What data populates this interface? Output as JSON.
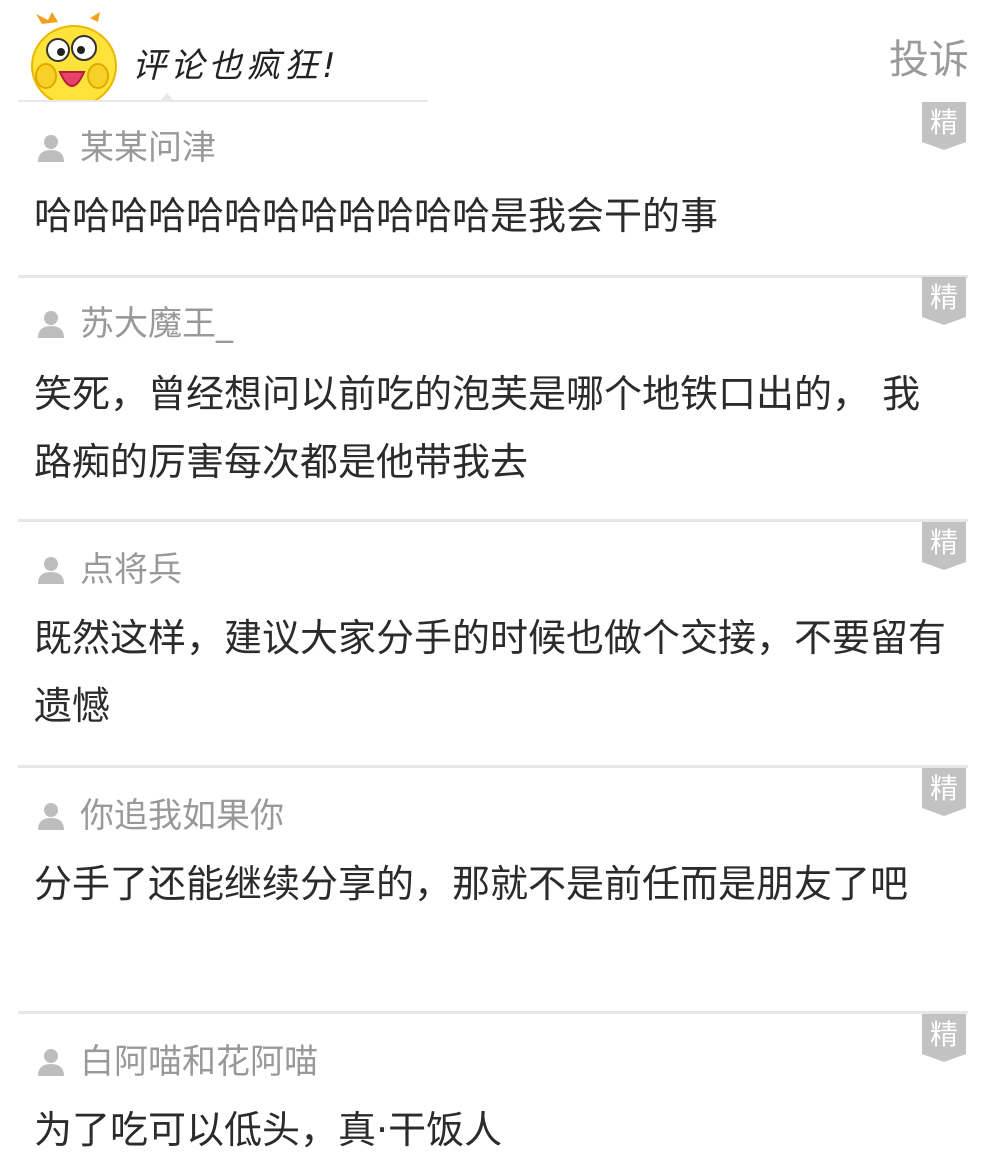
{
  "header": {
    "title": "评论也疯狂!",
    "report_label": "投诉",
    "mascot_icon": "yellow-chick-mascot-icon"
  },
  "badge_label": "精",
  "comments": [
    {
      "username": "某某问津",
      "text": "哈哈哈哈哈哈哈哈哈哈哈哈是我会干的事"
    },
    {
      "username": "苏大魔王_",
      "text": "笑死，曾经想问以前吃的泡芙是哪个地铁口出的， 我路痴的厉害每次都是他带我去"
    },
    {
      "username": "点将兵",
      "text": "既然这样，建议大家分手的时候也做个交接，不要留有遗憾"
    },
    {
      "username": "你追我如果你",
      "text": "分手了还能继续分享的，那就不是前任而是朋友了吧"
    },
    {
      "username": "白阿喵和花阿喵",
      "text": "为了吃可以低头，真·干饭人"
    }
  ],
  "colors": {
    "badge_gray": "#c2c2c2",
    "username_gray": "#999999",
    "text_dark": "#2b2b2b",
    "divider": "#e6e6e6"
  }
}
